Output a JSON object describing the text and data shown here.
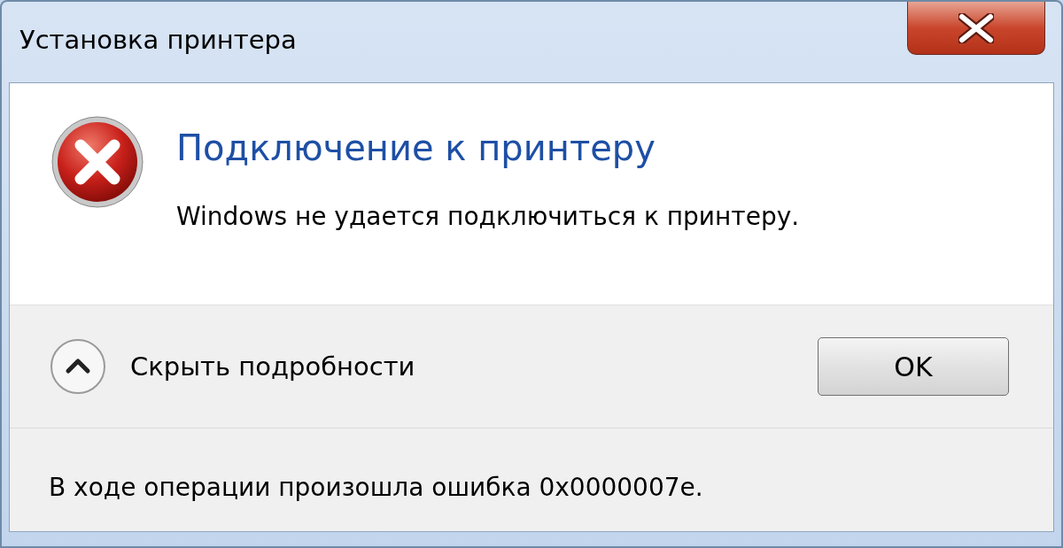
{
  "window": {
    "title": "Установка принтера"
  },
  "heading": "Подключение к принтеру",
  "message": "Windows не удается подключиться к принтеру.",
  "details_toggle": {
    "label": "Скрыть подробности",
    "expanded": true
  },
  "buttons": [
    {
      "label": "OK"
    }
  ],
  "details": "В ходе операции произошла ошибка 0x0000007e."
}
